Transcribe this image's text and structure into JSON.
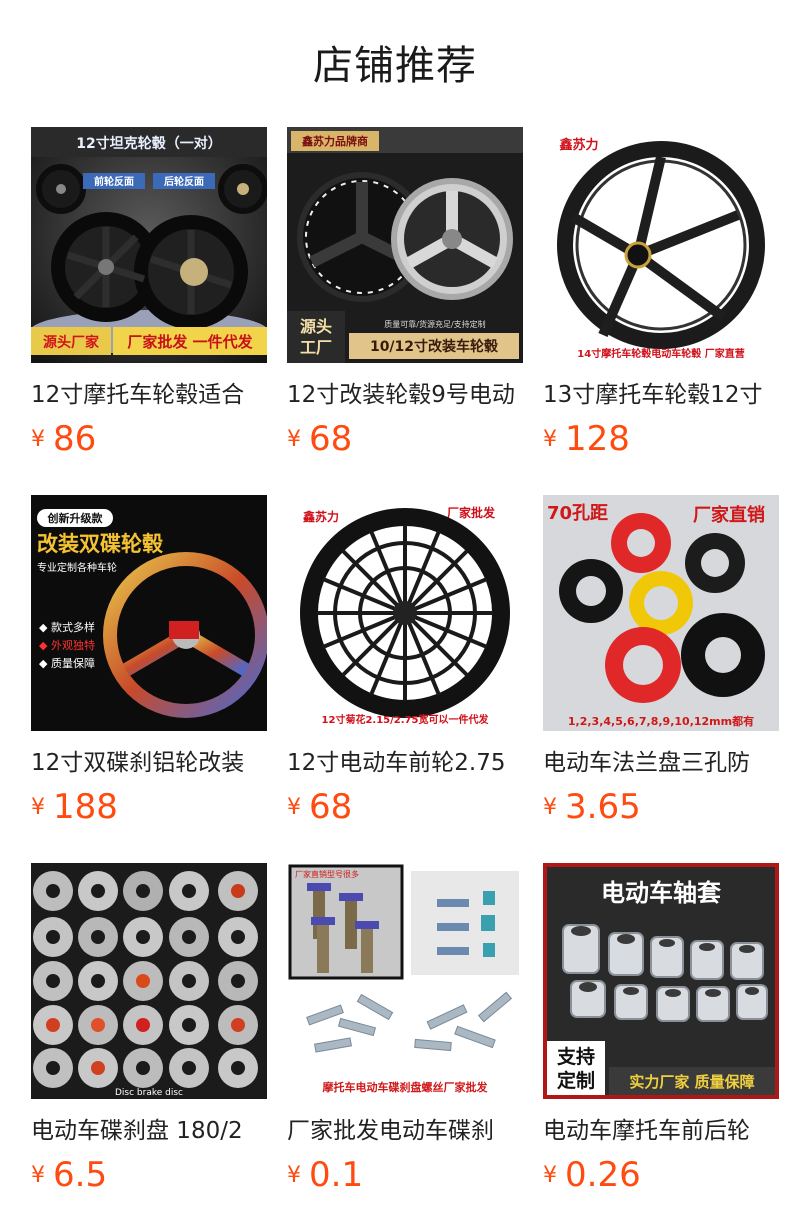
{
  "page": {
    "title": "店铺推荐"
  },
  "products": [
    {
      "name": "12寸摩托车轮毂适合",
      "currency": "¥",
      "price": "86",
      "thumb": [
        "12寸坦克轮毂（一对）",
        "前轮反面",
        "后轮反面",
        "源头厂家",
        "厂家批发 一件代发"
      ]
    },
    {
      "name": "12寸改装轮毂9号电动",
      "currency": "¥",
      "price": "68",
      "thumb": [
        "鑫苏力品牌商",
        "源头",
        "工厂",
        "质量可靠/货源充足/支持定制",
        "10/12寸改装车轮毂"
      ]
    },
    {
      "name": "13寸摩托车轮毂12寸",
      "currency": "¥",
      "price": "128",
      "thumb": [
        "鑫苏力",
        "14寸摩托车轮毂电动车轮毂 厂家直营"
      ]
    },
    {
      "name": "12寸双碟刹铝轮改装",
      "currency": "¥",
      "price": "188",
      "thumb": [
        "创新升级款",
        "改装双碟轮毂",
        "专业定制各种车轮",
        "◆ 款式多样",
        "◆ 外观独特",
        "◆ 质量保障"
      ]
    },
    {
      "name": "12寸电动车前轮2.75",
      "currency": "¥",
      "price": "68",
      "thumb": [
        "鑫苏力",
        "厂家批发",
        "12寸菊花2.15/2.75宽可以一件代发"
      ]
    },
    {
      "name": "电动车法兰盘三孔防",
      "currency": "¥",
      "price": "3.65",
      "thumb": [
        "70孔距",
        "厂家直销",
        "1,2,3,4,5,6,7,8,9,10,12mm都有"
      ]
    },
    {
      "name": "电动车碟刹盘 180/2",
      "currency": "¥",
      "price": "6.5",
      "thumb": [
        "Disc brake disc"
      ]
    },
    {
      "name": "厂家批发电动车碟刹",
      "currency": "¥",
      "price": "0.1",
      "thumb": [
        "厂家直销型号很多",
        "摩托车电动车碟刹盘螺丝厂家批发"
      ]
    },
    {
      "name": "电动车摩托车前后轮",
      "currency": "¥",
      "price": "0.26",
      "thumb": [
        "电动车轴套",
        "支持",
        "定制",
        "实力厂家 质量保障"
      ]
    }
  ],
  "colors": {
    "price": "#ff4a10",
    "title": "#1a1a1a",
    "name": "#222222"
  }
}
